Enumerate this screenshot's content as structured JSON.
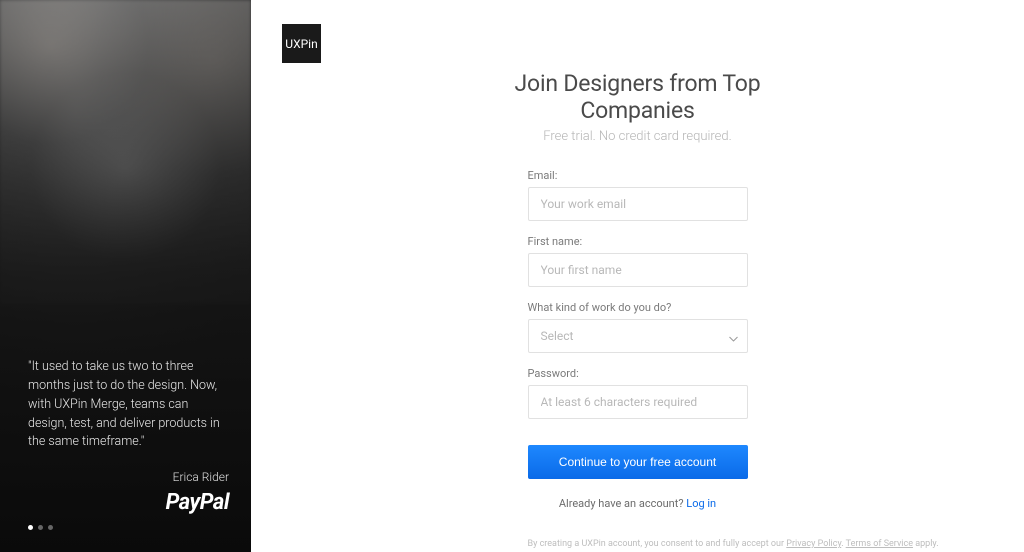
{
  "brand": "UXPin",
  "sidebar": {
    "quote": "\"It used to take us two to three months just to do the design. Now, with UXPin Merge, teams can design, test, and deliver products in the same timeframe.\"",
    "author": "Erica Rider",
    "company": "PayPal",
    "slide_count": 3,
    "active_slide": 0
  },
  "signup": {
    "title": "Join Designers from Top Companies",
    "subtitle": "Free trial. No credit card required.",
    "fields": {
      "email": {
        "label": "Email:",
        "placeholder": "Your work email",
        "value": ""
      },
      "first_name": {
        "label": "First name:",
        "placeholder": "Your first name",
        "value": ""
      },
      "work": {
        "label": "What kind of work do you do?",
        "placeholder": "Select",
        "value": ""
      },
      "password": {
        "label": "Password:",
        "placeholder": "At least 6 characters required",
        "value": ""
      }
    },
    "button": "Continue to your free account",
    "already_text": "Already have an account? ",
    "login_link": "Log in",
    "legal_prefix": "By creating a UXPin account, you consent to and fully accept our ",
    "privacy": "Privacy Policy",
    "legal_sep": ". ",
    "terms": "Terms of Service",
    "legal_suffix": " apply."
  }
}
